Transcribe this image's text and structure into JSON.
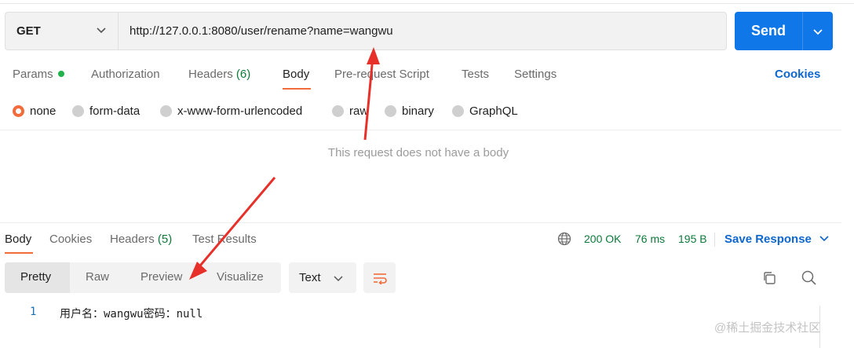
{
  "request": {
    "method": "GET",
    "url": "http://127.0.0.1:8080/user/rename?name=wangwu",
    "send_label": "Send"
  },
  "request_tabs": {
    "params": "Params",
    "authorization": "Authorization",
    "headers": "Headers",
    "headers_count": "(6)",
    "body": "Body",
    "pre_request_script": "Pre-request Script",
    "tests": "Tests",
    "settings": "Settings",
    "cookies": "Cookies",
    "active": "Body"
  },
  "body_types": {
    "none": "none",
    "form_data": "form-data",
    "urlencoded": "x-www-form-urlencoded",
    "raw": "raw",
    "binary": "binary",
    "graphql": "GraphQL",
    "selected": "none"
  },
  "empty_body_message": "This request does not have a body",
  "response_tabs": {
    "body": "Body",
    "cookies": "Cookies",
    "headers": "Headers",
    "headers_count": "(5)",
    "test_results": "Test Results",
    "active": "Body"
  },
  "response_status": {
    "code": "200 OK",
    "time": "76 ms",
    "size": "195 B",
    "save_response": "Save Response"
  },
  "format_options": {
    "pretty": "Pretty",
    "raw": "Raw",
    "preview": "Preview",
    "visualize": "Visualize",
    "active": "Pretty",
    "type": "Text"
  },
  "response_body": {
    "line_number": "1",
    "content": "用户名：wangwu密码：null"
  },
  "watermark": "@稀土掘金技术社区",
  "colors": {
    "accent_orange": "#f26b3a",
    "send_blue": "#0f77e8",
    "link_blue": "#0f66cc",
    "status_green": "#0d7a3a",
    "annotation_red": "#e8302a"
  }
}
